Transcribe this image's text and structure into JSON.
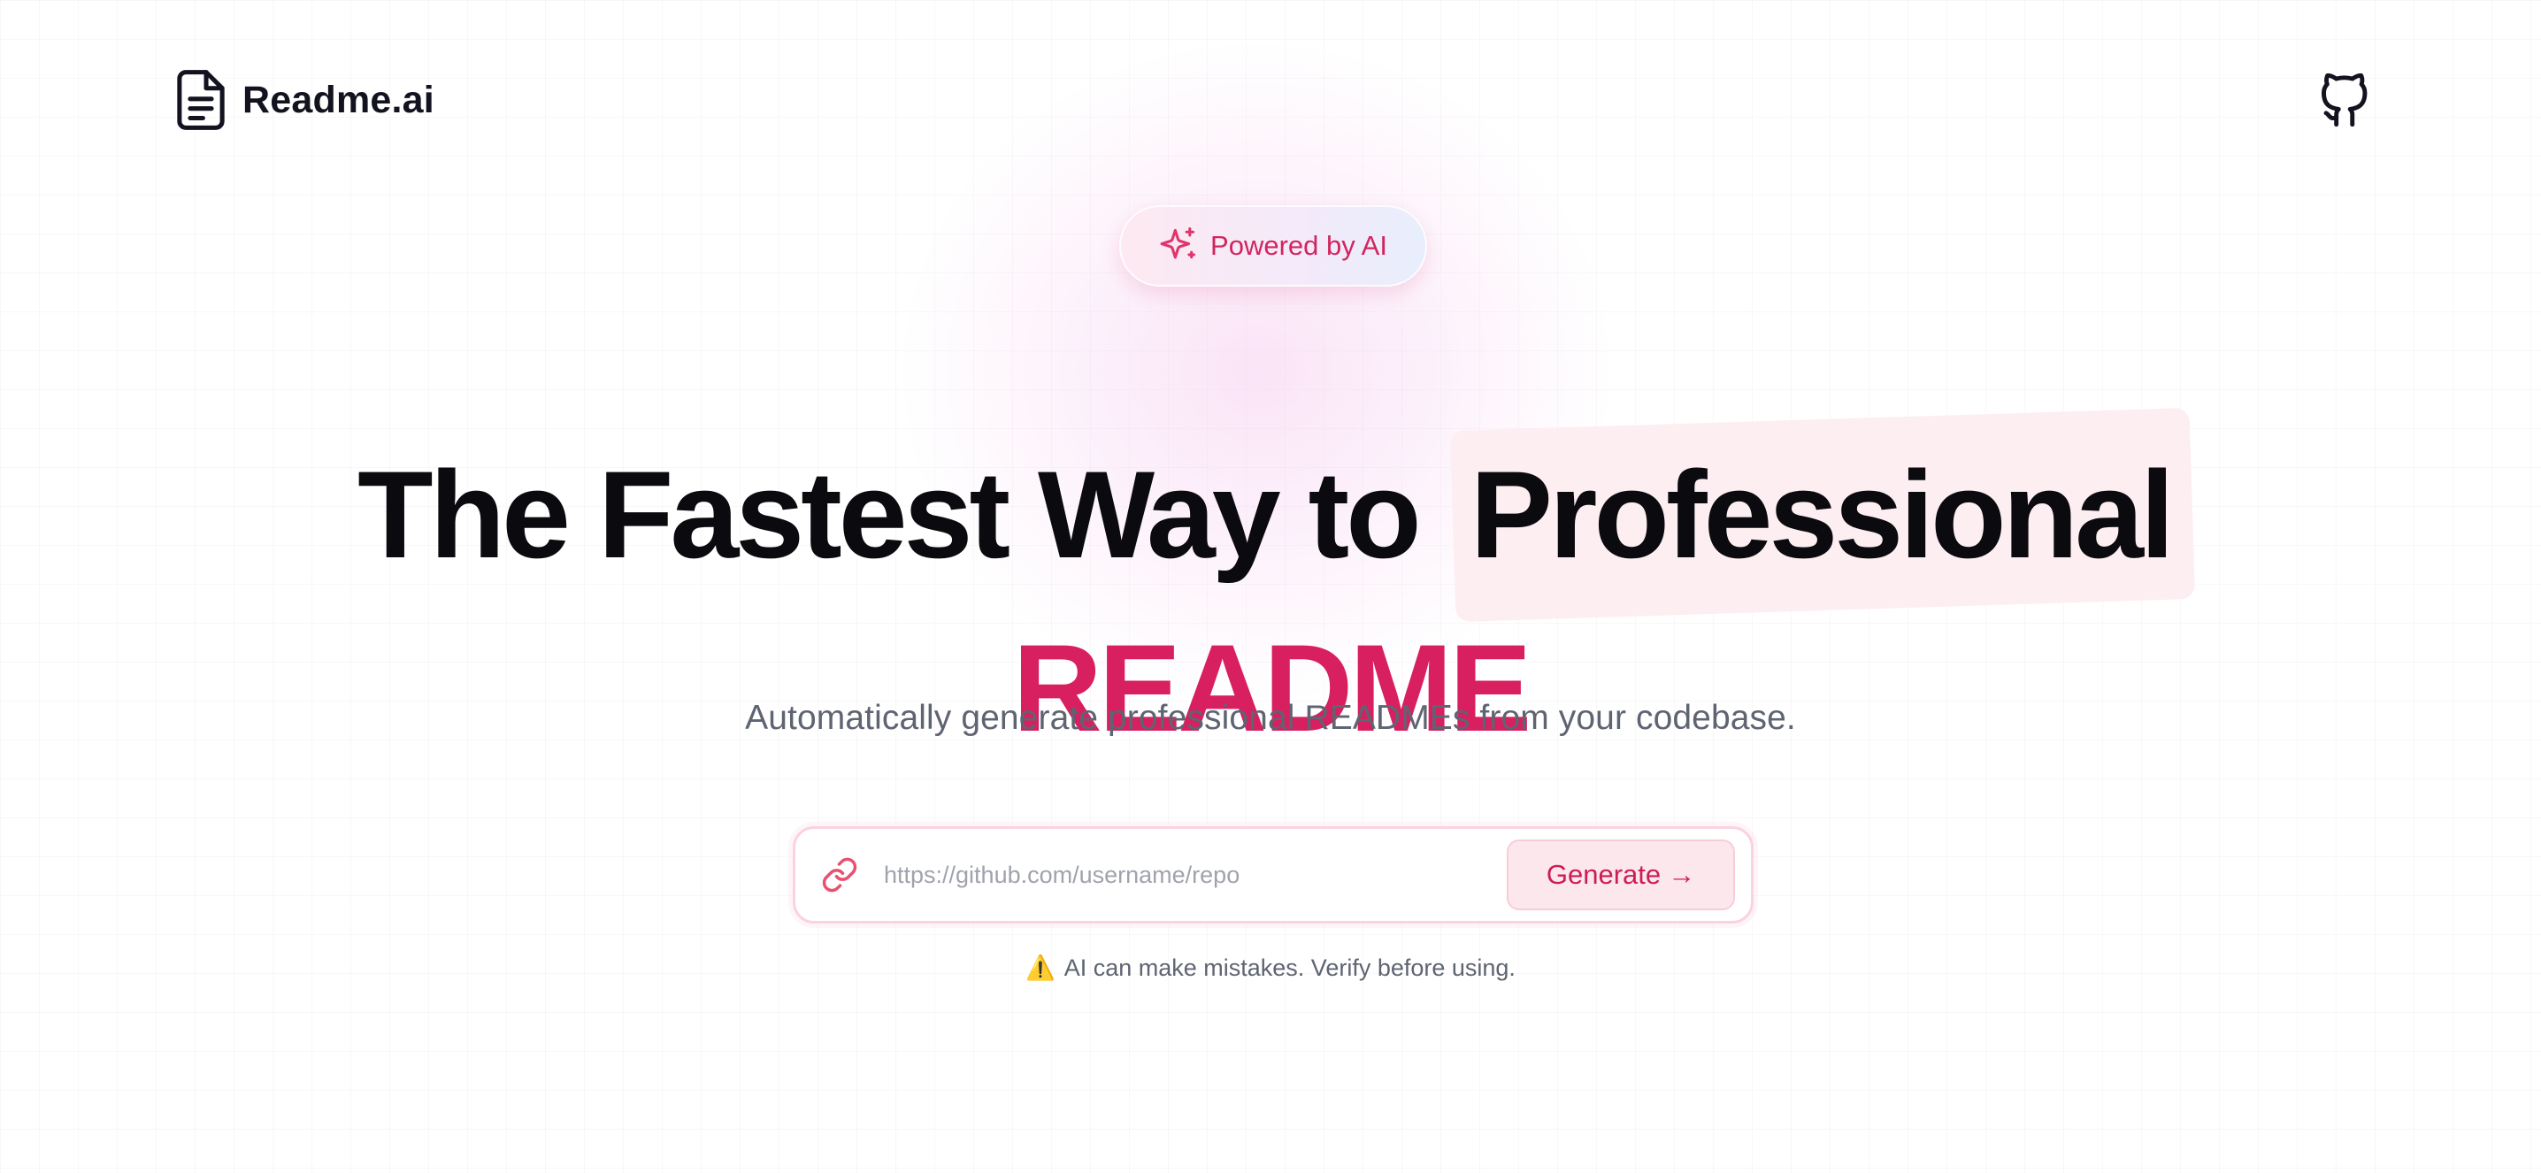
{
  "header": {
    "brand_name": "Readme.ai",
    "github_icon": "github-icon",
    "brand_icon": "document-icon"
  },
  "badge": {
    "label": "Powered by AI",
    "icon": "sparkle-icon"
  },
  "hero": {
    "headline_lead": "The Fastest Way to",
    "headline_highlight": "Professional",
    "headline_accent": "README",
    "subtitle": "Automatically generate professional READMEs from your codebase."
  },
  "form": {
    "repo_url_placeholder": "https://github.com/username/repo",
    "repo_url_value": "",
    "generate_label": "Generate",
    "generate_arrow": "→",
    "link_icon": "link-icon"
  },
  "disclaimer": {
    "icon_glyph": "⚠️",
    "text": "AI can make mistakes. Verify before using."
  },
  "colors": {
    "accent": "#d81f5f",
    "highlight_bg": "#fdeef1",
    "text_primary": "#0b0b0f",
    "text_muted": "#5f6472"
  }
}
